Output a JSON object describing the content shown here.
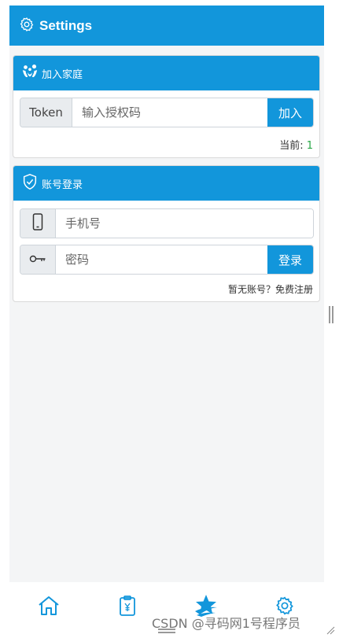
{
  "header": {
    "title": "Settings",
    "icon": "gear-icon"
  },
  "join_family": {
    "title": "加入家庭",
    "icon": "family-icon",
    "token_label": "Token",
    "token_placeholder": "输入授权码",
    "join_button": "加入",
    "current_label": "当前:",
    "current_value": "1"
  },
  "account_login": {
    "title": "账号登录",
    "icon": "shield-check-icon",
    "phone_placeholder": "手机号",
    "password_placeholder": "密码",
    "login_button": "登录",
    "register_text": "暂无账号？免费注册"
  },
  "bottom_nav": [
    {
      "name": "home",
      "icon": "home-icon"
    },
    {
      "name": "bill",
      "icon": "clipboard-yen-icon"
    },
    {
      "name": "featured",
      "icon": "star-icon"
    },
    {
      "name": "settings",
      "icon": "gear-icon"
    }
  ],
  "watermark": "CSDN @寻码网1号程序员",
  "colors": {
    "primary": "#1296db",
    "background": "#f4f5f6",
    "success": "#28a745"
  }
}
